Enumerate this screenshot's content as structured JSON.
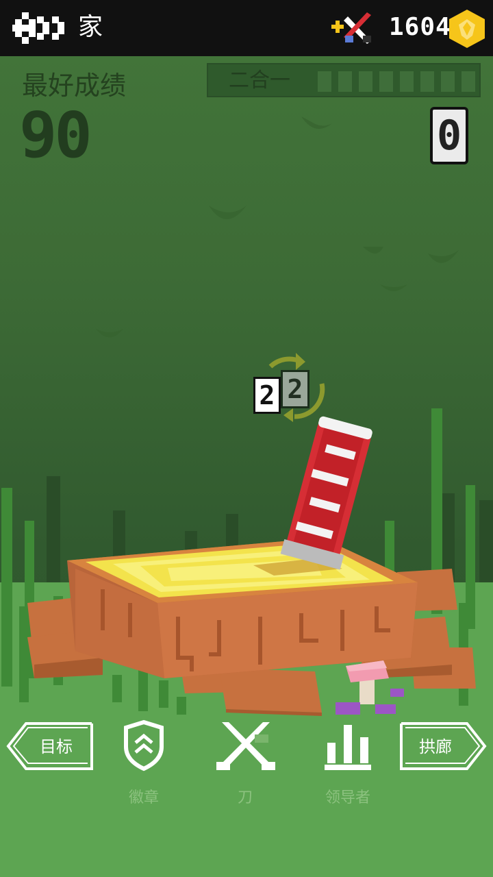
{
  "topbar": {
    "home_label": "家",
    "coins": "1604"
  },
  "stats": {
    "best_label": "最好成绩",
    "best_score": "90",
    "combo_label": "二合一",
    "current_score": "0"
  },
  "hit_counter": {
    "front": "2",
    "back": "2"
  },
  "nav": {
    "goals": "目标",
    "badges": "徽章",
    "knives": "刀",
    "leaders": "领导者",
    "arcade": "拱廊"
  },
  "colors": {
    "background": "#3d6b36",
    "ground": "#5da552",
    "coin": "#f6c51a",
    "knife": "#d62e35"
  },
  "icons": [
    "back-arrow-icon",
    "knife-shop-icon",
    "coin-icon",
    "shield-badge-icon",
    "crossed-knives-icon",
    "bar-chart-icon"
  ]
}
